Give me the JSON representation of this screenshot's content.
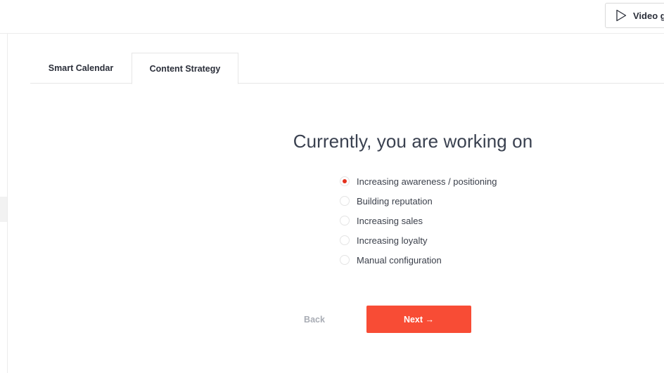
{
  "topbar": {
    "video_button_label": "Video gu",
    "video_button_icon": "play-icon"
  },
  "tabs": [
    {
      "label": "Smart Calendar",
      "active": false
    },
    {
      "label": "Content Strategy",
      "active": true
    }
  ],
  "main": {
    "heading": "Currently, you are working on",
    "options": [
      {
        "label": "Increasing awareness / positioning",
        "selected": true
      },
      {
        "label": "Building reputation",
        "selected": false
      },
      {
        "label": "Increasing sales",
        "selected": false
      },
      {
        "label": "Increasing loyalty",
        "selected": false
      },
      {
        "label": "Manual configuration",
        "selected": false
      }
    ]
  },
  "actions": {
    "back_label": "Back",
    "next_label": "Next →"
  },
  "colors": {
    "accent": "#f84c35",
    "radio_selected": "#e5321e",
    "muted_text": "#a9adb5"
  }
}
